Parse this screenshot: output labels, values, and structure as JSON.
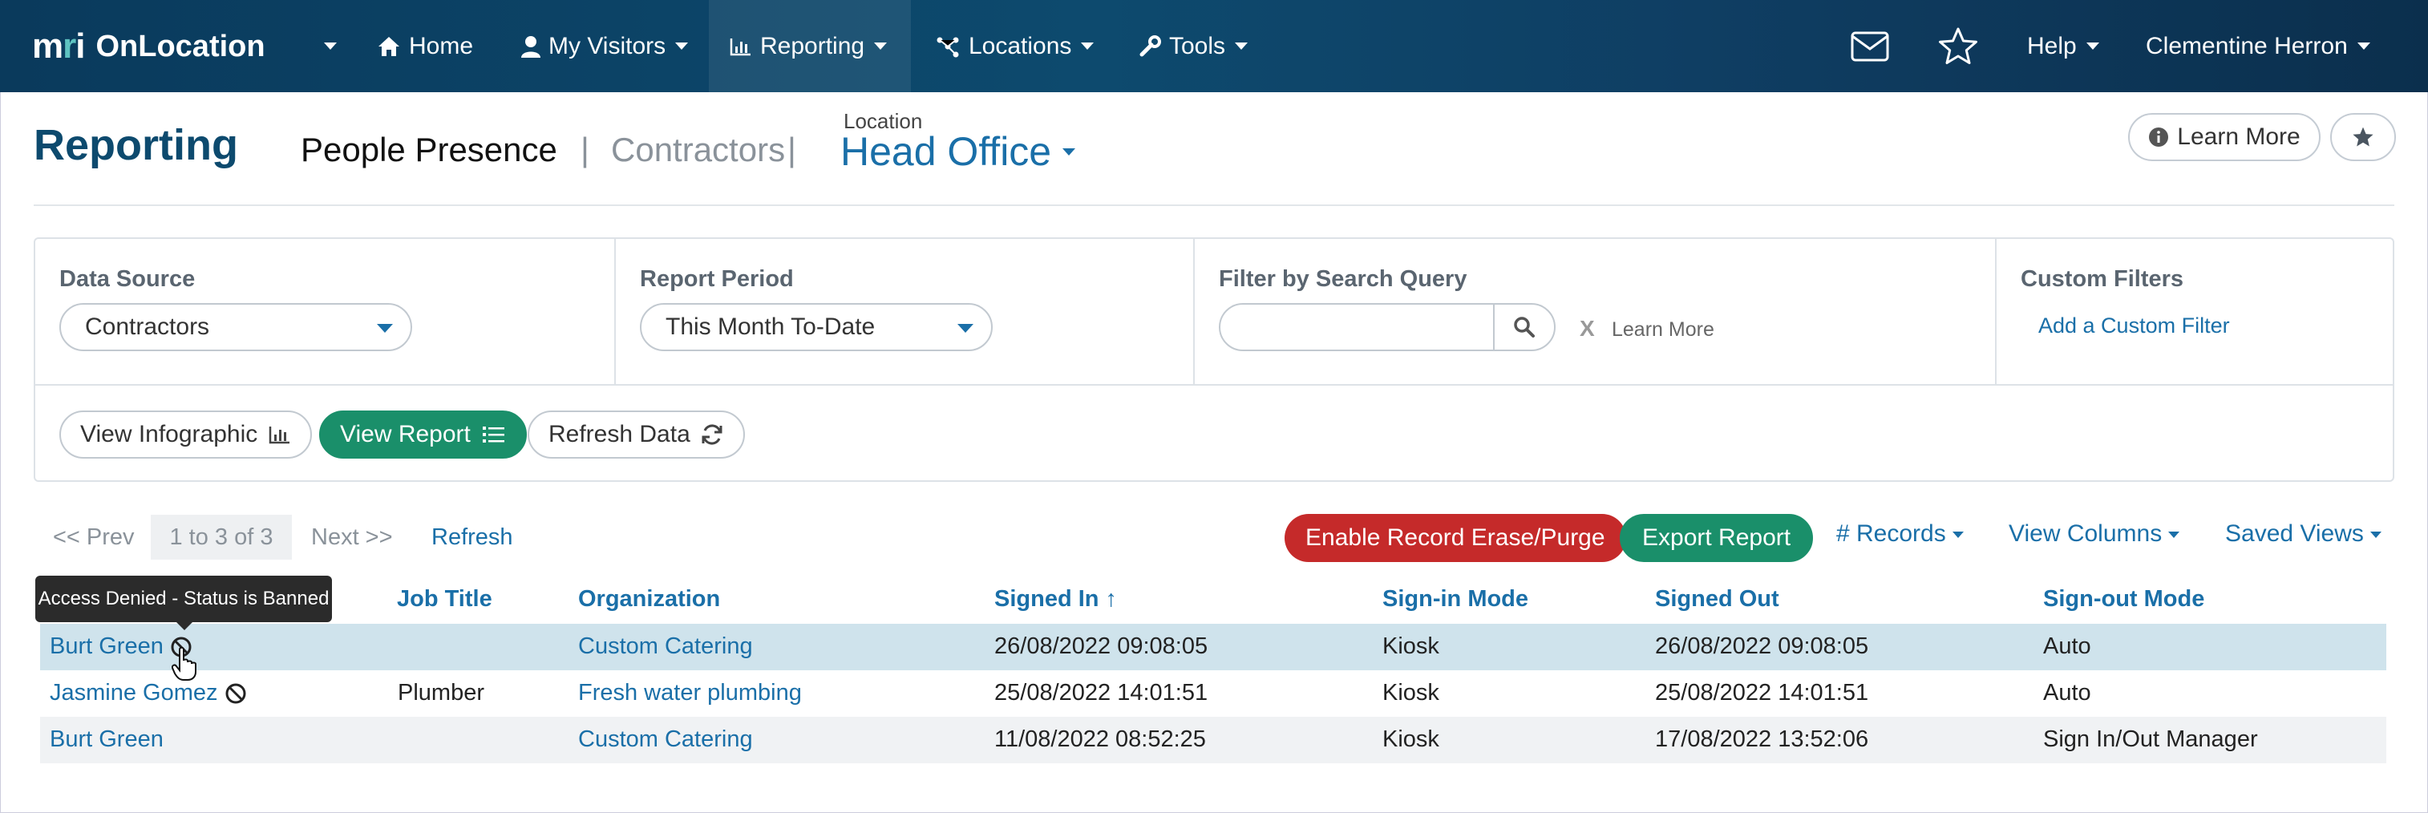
{
  "topbar": {
    "logo_mark": "mri",
    "app_name": "OnLocation",
    "nav": [
      {
        "label": "Home",
        "icon": "home-icon"
      },
      {
        "label": "My Visitors",
        "icon": "user-icon"
      },
      {
        "label": "Reporting",
        "icon": "bar-chart-icon"
      },
      {
        "label": "Locations",
        "icon": "network-icon"
      },
      {
        "label": "Tools",
        "icon": "wrench-icon"
      }
    ],
    "help_label": "Help",
    "user_name": "Clementine Herron"
  },
  "header": {
    "title": "Reporting",
    "crumb_active": "People Presence",
    "crumb_sep1": "|",
    "crumb_secondary": "Contractors",
    "crumb_sep2": "|",
    "location_label": "Location",
    "location_value": "Head Office",
    "learn_more": "Learn More"
  },
  "filters": {
    "data_source_label": "Data Source",
    "data_source_value": "Contractors",
    "report_period_label": "Report Period",
    "report_period_value": "This Month To-Date",
    "search_label": "Filter by Search Query",
    "search_value": "",
    "clear_x": "X",
    "search_learn_more": "Learn More",
    "custom_label": "Custom Filters",
    "custom_add": "Add a Custom Filter"
  },
  "actions": {
    "view_infographic": "View Infographic",
    "view_report": "View Report",
    "refresh_data": "Refresh Data"
  },
  "pager": {
    "prev": "<< Prev",
    "range": "1 to 3 of 3",
    "next": "Next >>",
    "refresh": "Refresh"
  },
  "toolbar": {
    "erase": "Enable Record Erase/Purge",
    "export": "Export Report",
    "records": "# Records",
    "view_columns": "View Columns",
    "saved_views": "Saved Views"
  },
  "table": {
    "headers": [
      "Job Title",
      "Organization",
      "Signed In ↑",
      "Sign-in Mode",
      "Signed Out",
      "Sign-out Mode"
    ],
    "rows": [
      {
        "name": "Burt Green",
        "banned": true,
        "job": "",
        "org": "Custom Catering",
        "in": "26/08/2022 09:08:05",
        "in_mode": "Kiosk",
        "out": "26/08/2022 09:08:05",
        "out_mode": "Auto"
      },
      {
        "name": "Jasmine Gomez",
        "banned": true,
        "job": "Plumber",
        "org": "Fresh water plumbing",
        "in": "25/08/2022 14:01:51",
        "in_mode": "Kiosk",
        "out": "25/08/2022 14:01:51",
        "out_mode": "Auto"
      },
      {
        "name": "Burt Green",
        "banned": false,
        "job": "",
        "org": "Custom Catering",
        "in": "11/08/2022 08:52:25",
        "in_mode": "Kiosk",
        "out": "17/08/2022 13:52:06",
        "out_mode": "Sign In/Out Manager"
      }
    ]
  },
  "tooltip": "Access Denied - Status is Banned",
  "colors": {
    "brand_dark": "#0d4a6e",
    "link": "#1a6fa8",
    "green": "#1a8f6a",
    "red": "#c52a2a",
    "row_highlight": "#cfe3ec",
    "row_alt": "#f0f2f4"
  }
}
